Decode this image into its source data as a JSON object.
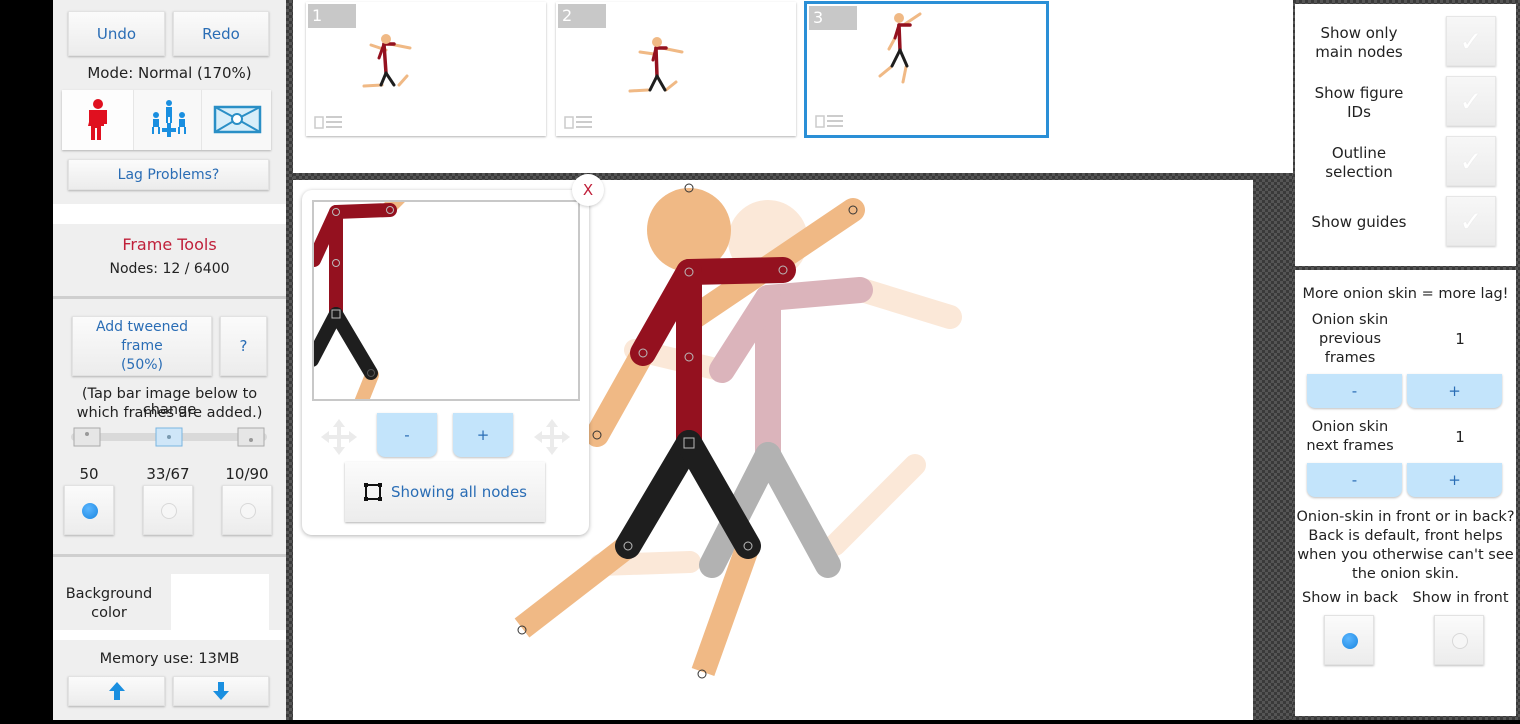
{
  "left_panel": {
    "undo_label": "Undo",
    "redo_label": "Redo",
    "mode_text": "Mode: Normal (170%)",
    "mode_buttons": [
      {
        "name": "single-figure-mode",
        "icon": "red-stickfigure-icon",
        "active": true
      },
      {
        "name": "multi-figure-mode",
        "icon": "group-move-icon",
        "active": false
      },
      {
        "name": "scene-mode",
        "icon": "scene-frame-icon",
        "active": false
      }
    ],
    "lag_label": "Lag Problems?",
    "frame_tools_title": "Frame Tools",
    "nodes_text": "Nodes: 12 / 6400",
    "add_tween_label_1": "Add tweened frame",
    "add_tween_label_2": "(50%)",
    "help_label": "?",
    "tap_hint_1": "(Tap bar image below to change",
    "tap_hint_2": "which frames are added.)",
    "tween_options": [
      {
        "label": "50",
        "selected": true
      },
      {
        "label": "33/67",
        "selected": false
      },
      {
        "label": "10/90",
        "selected": false
      }
    ],
    "background_label_1": "Background",
    "background_label_2": "color",
    "background_color": "#ffffff",
    "memory_text": "Memory use: 13MB",
    "up_icon": "arrow-up-icon",
    "down_icon": "arrow-down-icon"
  },
  "frames": [
    {
      "number": "1",
      "selected": false
    },
    {
      "number": "2",
      "selected": false
    },
    {
      "number": "3",
      "selected": true
    }
  ],
  "zoom_popup": {
    "close_label": "X",
    "minus_label": "-",
    "plus_label": "+",
    "show_nodes_label": "Showing all nodes"
  },
  "right_panel": {
    "toggles": [
      {
        "label_1": "Show only",
        "label_2": "main nodes",
        "checked": false
      },
      {
        "label_1": "Show figure",
        "label_2": "IDs",
        "checked": false
      },
      {
        "label_1": "Outline",
        "label_2": "selection",
        "checked": false
      },
      {
        "label_1": "Show guides",
        "label_2": "",
        "checked": false
      }
    ],
    "lag_warning": "More onion skin = more lag!",
    "onion_prev_1": "Onion skin",
    "onion_prev_2": "previous",
    "onion_prev_3": "frames",
    "onion_prev_value": "1",
    "onion_next_1": "Onion skin",
    "onion_next_2": "next frames",
    "onion_next_value": "1",
    "minus_label": "-",
    "plus_label": "+",
    "front_back_q1": "Onion-skin in front or in back?",
    "front_back_q2": "Back is default, front helps",
    "front_back_q3": "when you otherwise can't see",
    "front_back_q4": "the onion skin.",
    "show_back_label": "Show in back",
    "show_front_label": "Show in front",
    "show_back_selected": true,
    "show_front_selected": false
  },
  "colors": {
    "accent_blue": "#2a8fd6",
    "title_red": "#c0203a",
    "figure_shirt": "#94111f",
    "figure_skin": "#f0b985",
    "figure_pants": "#1e1e1e"
  }
}
